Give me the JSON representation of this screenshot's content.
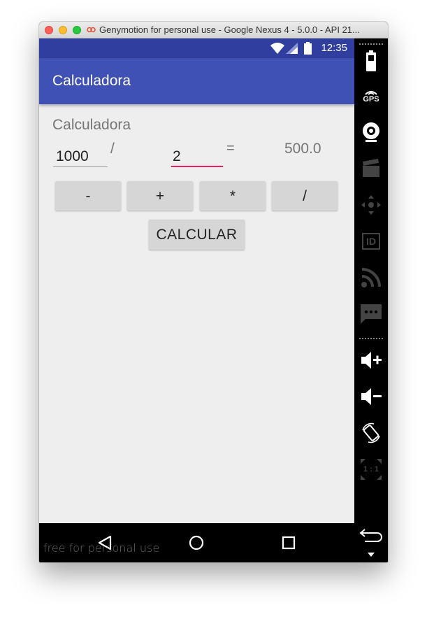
{
  "window": {
    "title": "Genymotion for personal use - Google Nexus 4 - 5.0.0 - API 21..."
  },
  "status_bar": {
    "time": "12:35",
    "icons": [
      "wifi-icon",
      "signal-icon",
      "battery-icon"
    ]
  },
  "app_bar": {
    "title": "Calculadora"
  },
  "main": {
    "label": "Calculadora",
    "operand_a": "1000",
    "operator_symbol": "/",
    "operand_b": "2",
    "equals": "=",
    "result": "500.0",
    "operator_buttons": [
      "-",
      "+",
      "*",
      "/"
    ],
    "calculate_label": "CALCULAR"
  },
  "nav_bar": {
    "icons": [
      "back-icon",
      "home-icon",
      "recents-icon"
    ],
    "watermark": "free for personal use"
  },
  "genymotion_toolbar": {
    "gps_label": "GPS",
    "id_label": "ID",
    "scale_label": "1 : 1",
    "icons": [
      "battery-widget-icon",
      "gps-icon",
      "webcam-icon",
      "capture-icon",
      "remote-control-icon",
      "device-id-icon",
      "network-icon",
      "sms-icon",
      "volume-up-icon",
      "volume-down-icon",
      "rotate-icon",
      "scale-icon",
      "back-icon",
      "more-icon"
    ]
  },
  "colors": {
    "primary": "#3f51b5",
    "primary_dark": "#303f9f",
    "accent": "#e91e63",
    "background": "#eeeeee"
  }
}
